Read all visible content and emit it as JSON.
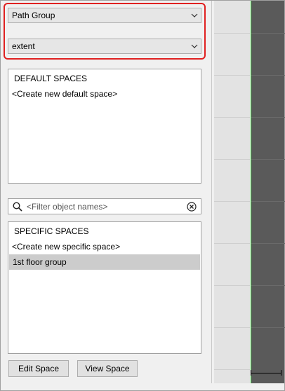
{
  "path_group_select": {
    "value": "Path Group"
  },
  "extent_select": {
    "value": "extent"
  },
  "default_spaces": {
    "header": "DEFAULT SPACES",
    "items": [
      {
        "label": "<Create new default space>"
      }
    ]
  },
  "filter": {
    "placeholder": "<Filter object names>"
  },
  "specific_spaces": {
    "header": "SPECIFIC SPACES",
    "items": [
      {
        "label": "<Create new specific space>",
        "selected": false
      },
      {
        "label": "1st floor group",
        "selected": true
      }
    ]
  },
  "buttons": {
    "edit_space": "Edit Space",
    "view_space": "View Space"
  },
  "colors": {
    "highlight": "#e02020",
    "selected_row": "#cccccc",
    "canvas": "#5a5a5a",
    "canvas_edge": "#35d435"
  }
}
